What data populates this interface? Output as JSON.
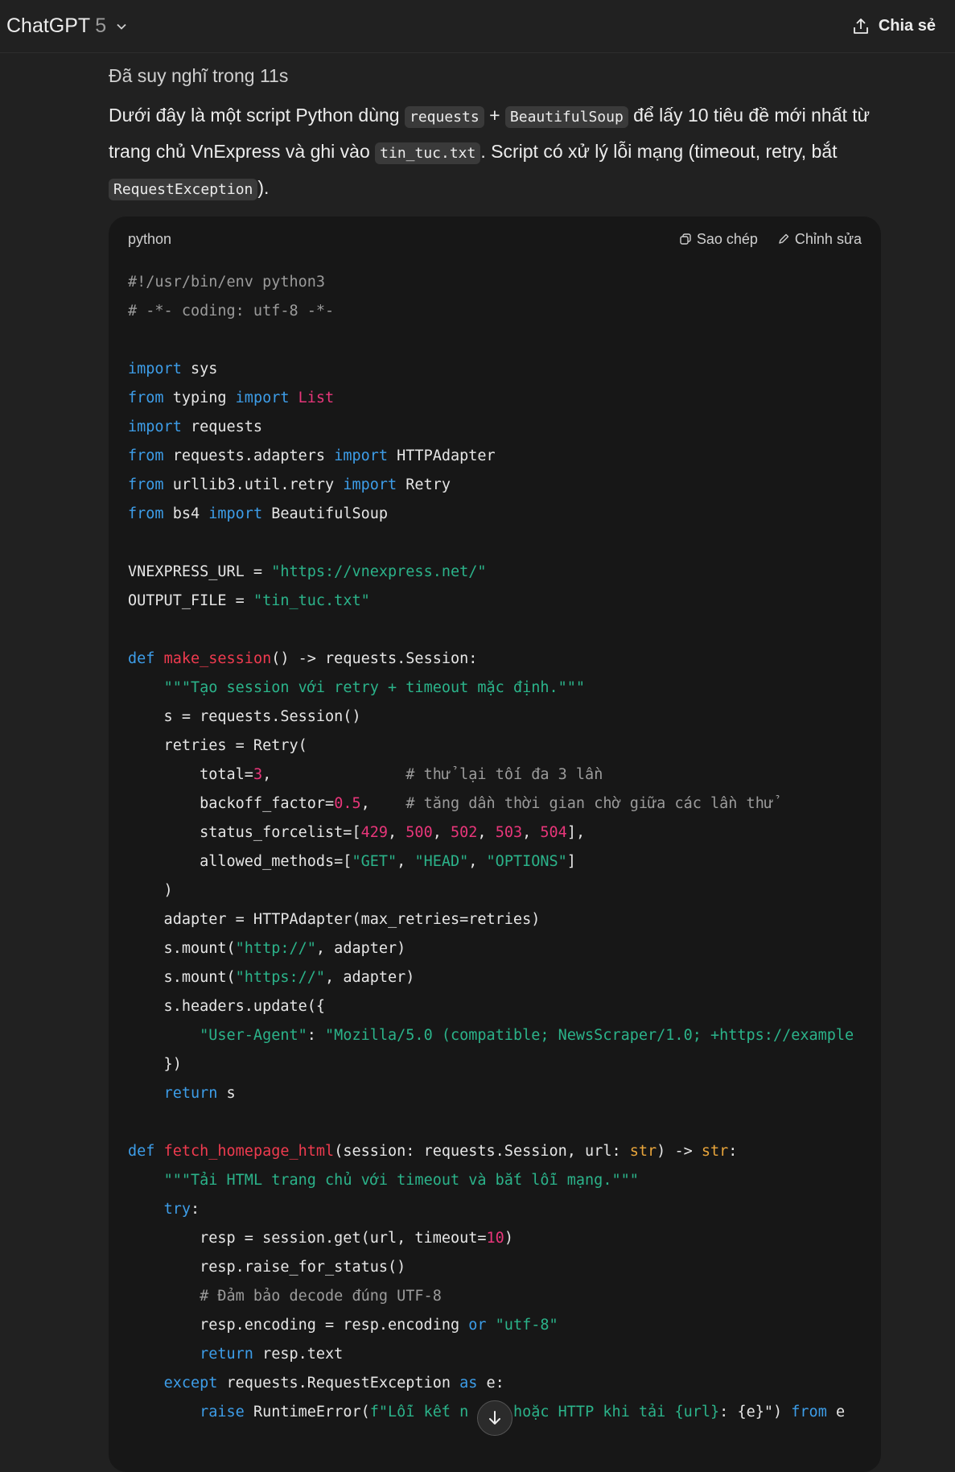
{
  "header": {
    "app_name": "ChatGPT",
    "model_version": "5",
    "share_label": "Chia sẻ"
  },
  "message": {
    "thought_label": "Đã suy nghĩ trong 11s",
    "intro": {
      "p1": "Dưới đây là một script Python dùng ",
      "code1": "requests",
      "p2": " + ",
      "code2": "BeautifulSoup",
      "p3": " để lấy 10 tiêu đề mới nhất từ trang chủ VnExpress và ghi vào ",
      "code3": "tin_tuc.txt",
      "p4": ". Script có xử lý lỗi mạng (timeout, retry, bắt ",
      "code4": "RequestException",
      "p5": ")."
    }
  },
  "codeblock": {
    "language": "python",
    "copy_label": "Sao chép",
    "edit_label": "Chỉnh sửa",
    "lines": [
      [
        [
          "c",
          "#!/usr/bin/env python3"
        ]
      ],
      [
        [
          "c",
          "# -*- coding: utf-8 -*-"
        ]
      ],
      [],
      [
        [
          "k",
          "import"
        ],
        [
          "p",
          " sys"
        ]
      ],
      [
        [
          "k",
          "from"
        ],
        [
          "p",
          " typing "
        ],
        [
          "k",
          "import"
        ],
        [
          "n",
          " List"
        ]
      ],
      [
        [
          "k",
          "import"
        ],
        [
          "p",
          " requests"
        ]
      ],
      [
        [
          "k",
          "from"
        ],
        [
          "p",
          " requests.adapters "
        ],
        [
          "k",
          "import"
        ],
        [
          "p",
          " HTTPAdapter"
        ]
      ],
      [
        [
          "k",
          "from"
        ],
        [
          "p",
          " urllib3.util.retry "
        ],
        [
          "k",
          "import"
        ],
        [
          "p",
          " Retry"
        ]
      ],
      [
        [
          "k",
          "from"
        ],
        [
          "p",
          " bs4 "
        ],
        [
          "k",
          "import"
        ],
        [
          "p",
          " BeautifulSoup"
        ]
      ],
      [],
      [
        [
          "p",
          "VNEXPRESS_URL = "
        ],
        [
          "s",
          "\"https://vnexpress.net/\""
        ]
      ],
      [
        [
          "p",
          "OUTPUT_FILE = "
        ],
        [
          "s",
          "\"tin_tuc.txt\""
        ]
      ],
      [],
      [
        [
          "k",
          "def"
        ],
        [
          "p",
          " "
        ],
        [
          "f",
          "make_session"
        ],
        [
          "p",
          "() -> requests.Session:"
        ]
      ],
      [
        [
          "p",
          "    "
        ],
        [
          "s",
          "\"\"\"Tạo session với retry + timeout mặc định.\"\"\""
        ]
      ],
      [
        [
          "p",
          "    s = requests.Session()"
        ]
      ],
      [
        [
          "p",
          "    retries = Retry("
        ]
      ],
      [
        [
          "p",
          "        total="
        ],
        [
          "n",
          "3"
        ],
        [
          "p",
          ",               "
        ],
        [
          "c",
          "# thử lại tối đa 3 lần"
        ]
      ],
      [
        [
          "p",
          "        backoff_factor="
        ],
        [
          "n",
          "0.5"
        ],
        [
          "p",
          ",    "
        ],
        [
          "c",
          "# tăng dần thời gian chờ giữa các lần thử"
        ]
      ],
      [
        [
          "p",
          "        status_forcelist=["
        ],
        [
          "n",
          "429"
        ],
        [
          "p",
          ", "
        ],
        [
          "n",
          "500"
        ],
        [
          "p",
          ", "
        ],
        [
          "n",
          "502"
        ],
        [
          "p",
          ", "
        ],
        [
          "n",
          "503"
        ],
        [
          "p",
          ", "
        ],
        [
          "n",
          "504"
        ],
        [
          "p",
          "],"
        ]
      ],
      [
        [
          "p",
          "        allowed_methods=["
        ],
        [
          "s",
          "\"GET\""
        ],
        [
          "p",
          ", "
        ],
        [
          "s",
          "\"HEAD\""
        ],
        [
          "p",
          ", "
        ],
        [
          "s",
          "\"OPTIONS\""
        ],
        [
          "p",
          "]"
        ]
      ],
      [
        [
          "p",
          "    )"
        ]
      ],
      [
        [
          "p",
          "    adapter = HTTPAdapter(max_retries=retries)"
        ]
      ],
      [
        [
          "p",
          "    s.mount("
        ],
        [
          "s",
          "\"http://\""
        ],
        [
          "p",
          ", adapter)"
        ]
      ],
      [
        [
          "p",
          "    s.mount("
        ],
        [
          "s",
          "\"https://\""
        ],
        [
          "p",
          ", adapter)"
        ]
      ],
      [
        [
          "p",
          "    s.headers.update({"
        ]
      ],
      [
        [
          "p",
          "        "
        ],
        [
          "s",
          "\"User-Agent\""
        ],
        [
          "p",
          ": "
        ],
        [
          "s",
          "\"Mozilla/5.0 (compatible; NewsScraper/1.0; +https://example"
        ]
      ],
      [
        [
          "p",
          "    })"
        ]
      ],
      [
        [
          "p",
          "    "
        ],
        [
          "k",
          "return"
        ],
        [
          "p",
          " s"
        ]
      ],
      [],
      [
        [
          "k",
          "def"
        ],
        [
          "p",
          " "
        ],
        [
          "f",
          "fetch_homepage_html"
        ],
        [
          "p",
          "(session: requests.Session, url: "
        ],
        [
          "b",
          "str"
        ],
        [
          "p",
          ") -> "
        ],
        [
          "b",
          "str"
        ],
        [
          "p",
          ":"
        ]
      ],
      [
        [
          "p",
          "    "
        ],
        [
          "s",
          "\"\"\"Tải HTML trang chủ với timeout và bắt lỗi mạng.\"\"\""
        ]
      ],
      [
        [
          "p",
          "    "
        ],
        [
          "k",
          "try"
        ],
        [
          "p",
          ":"
        ]
      ],
      [
        [
          "p",
          "        resp = session.get(url, timeout="
        ],
        [
          "n",
          "10"
        ],
        [
          "p",
          ")"
        ]
      ],
      [
        [
          "p",
          "        resp.raise_for_status()"
        ]
      ],
      [
        [
          "p",
          "        "
        ],
        [
          "c",
          "# Đảm bảo decode đúng UTF-8"
        ]
      ],
      [
        [
          "p",
          "        resp.encoding = resp.encoding "
        ],
        [
          "k",
          "or"
        ],
        [
          "p",
          " "
        ],
        [
          "s",
          "\"utf-8\""
        ]
      ],
      [
        [
          "p",
          "        "
        ],
        [
          "k",
          "return"
        ],
        [
          "p",
          " resp.text"
        ]
      ],
      [
        [
          "p",
          "    "
        ],
        [
          "k",
          "except"
        ],
        [
          "p",
          " requests.RequestException "
        ],
        [
          "k",
          "as"
        ],
        [
          "p",
          " e:"
        ]
      ],
      [
        [
          "p",
          "        "
        ],
        [
          "k",
          "raise"
        ],
        [
          "p",
          " RuntimeError("
        ],
        [
          "s",
          "f\"Lỗi kết n"
        ],
        [
          "s",
          "     hoặc HTTP khi tải "
        ],
        [
          "s",
          "{url}"
        ],
        [
          "p",
          ": {e}\") "
        ],
        [
          "k",
          "from"
        ],
        [
          "p",
          " e"
        ]
      ]
    ]
  },
  "icons": {
    "chevron": "chevron-down-icon",
    "share": "share-upload-icon",
    "copy": "copy-icon",
    "edit": "pencil-icon",
    "scroll": "arrow-down-icon"
  }
}
